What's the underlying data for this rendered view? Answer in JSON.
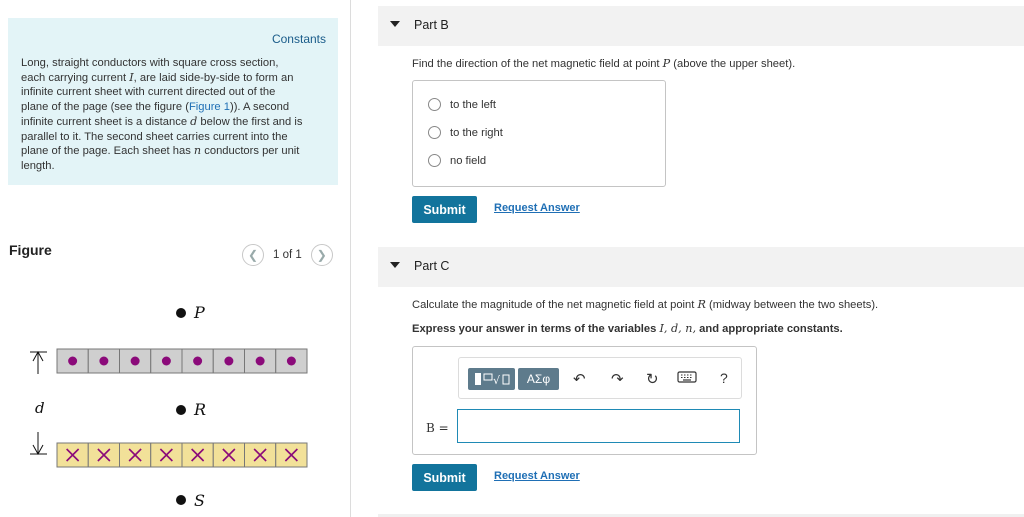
{
  "constants": {
    "title": "Constants",
    "lines": [
      "Long, straight conductors with square cross section,",
      "each carrying current ",
      "infinite current sheet with current directed out of the",
      "plane of the page (see the figure (",
      "infinite current sheet is a distance ",
      "parallel to it. The second sheet carries current into the",
      "plane of the page. Each sheet has ",
      "length."
    ],
    "line2_var": "I",
    "line2_tail": ", are laid side-by-side to form an",
    "line4_link": "Figure 1",
    "line4_tail": ")). A second",
    "line5_var": "d",
    "line5_tail": " below the first and is",
    "line7_var": "n",
    "line7_tail": " conductors per unit"
  },
  "figure": {
    "label": "Figure",
    "pager_text": "1 of 1",
    "prev_icon": "chevron-left-icon",
    "next_icon": "chevron-right-icon",
    "point_labels": [
      "P",
      "R",
      "S"
    ],
    "distance_label": "d",
    "upper_sheet_color": "#cfcfcf",
    "lower_sheet_color": "#f2e199",
    "dot_color": "#8b0a7a",
    "cross_color": "#8b0a7a",
    "conductor_count": 8
  },
  "partB": {
    "title": "Part B",
    "question_pre": "Find the direction of the net magnetic field at point ",
    "question_var": "P",
    "question_post": " (above the upper sheet).",
    "options": [
      "to the left",
      "to the right",
      "no field"
    ],
    "submit_label": "Submit",
    "request_label": "Request Answer"
  },
  "partC": {
    "title": "Part C",
    "question_pre": "Calculate the magnitude of the net magnetic field at point ",
    "question_var": "R",
    "question_post": " (midway between the two sheets).",
    "instruction_pre": "Express your answer in terms of the variables ",
    "instruction_vars": "I, d, n,",
    "instruction_post": " and appropriate constants.",
    "toolbar": {
      "templates_icon": "templates-icon",
      "greek_label": "ΑΣφ",
      "undo_icon": "undo-icon",
      "redo_icon": "redo-icon",
      "reset_icon": "reset-icon",
      "keyboard_icon": "keyboard-icon",
      "help_label": "?"
    },
    "variable_label": "B =",
    "input_value": "",
    "submit_label": "Submit",
    "request_label": "Request Answer"
  },
  "colors": {
    "accent": "#12749c",
    "link": "#1f6fb5",
    "constants_bg": "#e3f4f7",
    "toolbar_btn": "#5e7b8c"
  }
}
